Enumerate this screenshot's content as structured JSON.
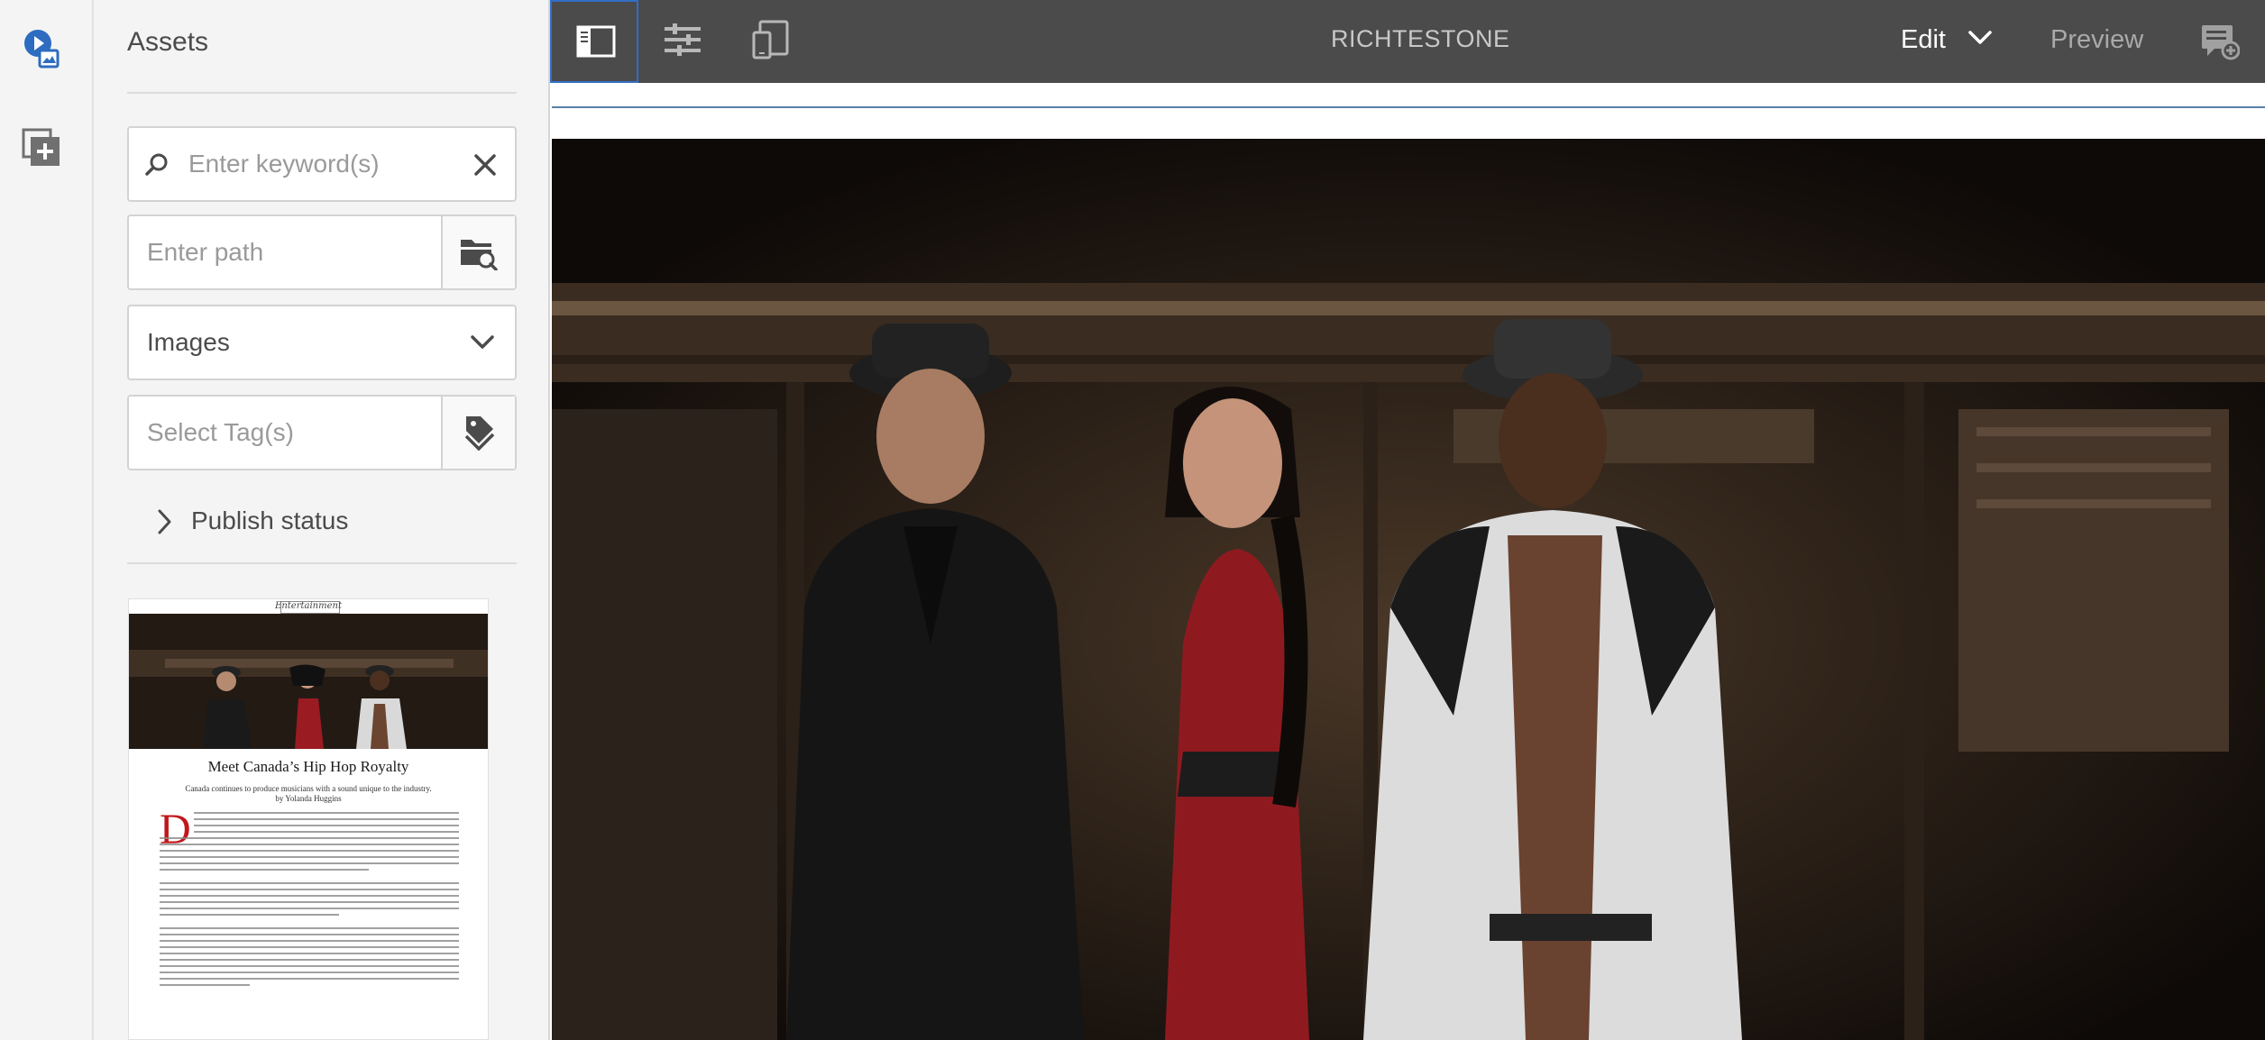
{
  "rail": {
    "items": [
      {
        "icon": "assets-icon",
        "active": true
      },
      {
        "icon": "components-icon",
        "active": false
      }
    ]
  },
  "assets_panel": {
    "title": "Assets",
    "search": {
      "placeholder": "Enter keyword(s)",
      "value": ""
    },
    "path": {
      "placeholder": "Enter path",
      "value": ""
    },
    "type_select": {
      "selected": "Images"
    },
    "tags": {
      "placeholder": "Select Tag(s)",
      "value": ""
    },
    "publish_status": {
      "label": "Publish status"
    },
    "thumbnail": {
      "kicker": "Entertainment",
      "headline": "Meet Canada’s Hip Hop Royalty",
      "subhead": "Canada continues to produce musicians with a sound unique to the industry.",
      "byline": "by Yolanda Huggins",
      "dropcap": "D"
    }
  },
  "toolbar": {
    "page_title": "RICHTESTONE",
    "mode": "Edit",
    "preview_label": "Preview",
    "buttons": [
      "toggle-side-panel-icon",
      "page-properties-icon",
      "emulator-icon",
      "annotations-icon"
    ]
  },
  "colors": {
    "toolbar_bg": "#4b4b4b",
    "accent": "#326ec8",
    "panel_bg": "#f4f4f4",
    "dropcap_red": "#c0181b"
  }
}
